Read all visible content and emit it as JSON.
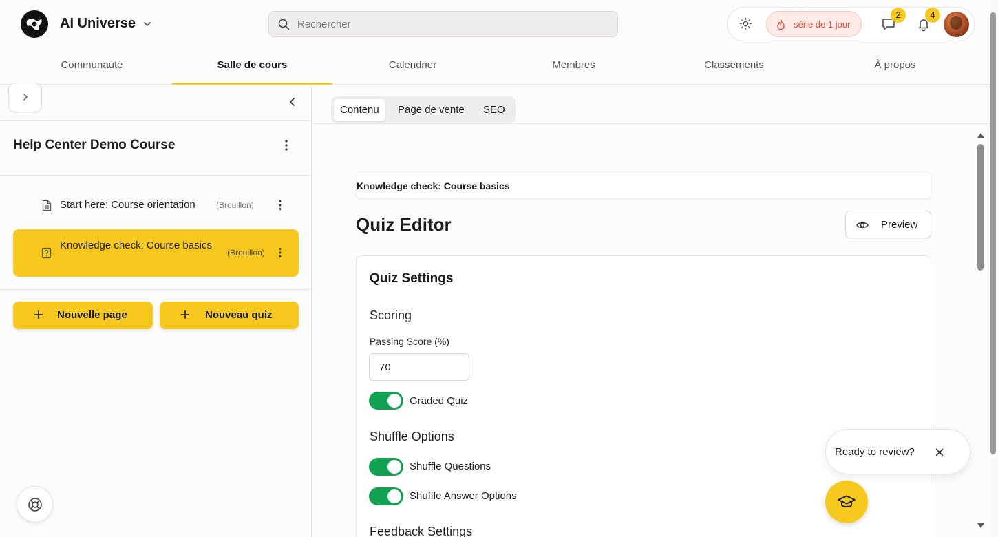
{
  "header": {
    "brand": "AI Universe",
    "search_placeholder": "Rechercher",
    "streak_label": "série de 1 jour",
    "messages_count": "2",
    "notifications_count": "4"
  },
  "nav": {
    "tabs": [
      {
        "label": "Communauté"
      },
      {
        "label": "Salle de cours"
      },
      {
        "label": "Calendrier"
      },
      {
        "label": "Membres"
      },
      {
        "label": "Classements"
      },
      {
        "label": "À propos"
      }
    ],
    "active": "Salle de cours"
  },
  "sidebar": {
    "course_title": "Help Center Demo Course",
    "lessons": [
      {
        "title": "Start here: Course orientation",
        "status": "(Brouillon)",
        "icon": "document-icon"
      },
      {
        "title": "Knowledge check: Course basics",
        "status": "(Brouillon)",
        "icon": "quiz-icon",
        "selected": true
      }
    ],
    "new_page_label": "Nouvelle page",
    "new_quiz_label": "Nouveau quiz"
  },
  "content": {
    "tabs": [
      {
        "label": "Contenu"
      },
      {
        "label": "Page de vente"
      },
      {
        "label": "SEO"
      }
    ],
    "active_tab": "Contenu",
    "item_title": "Knowledge check: Course basics",
    "editor_title": "Quiz Editor",
    "preview_label": "Preview",
    "settings": {
      "title": "Quiz Settings",
      "scoring_heading": "Scoring",
      "passing_score_label": "Passing Score (%)",
      "passing_score_value": "70",
      "graded_quiz_label": "Graded Quiz",
      "graded_quiz_on": true,
      "shuffle_heading": "Shuffle Options",
      "shuffle_questions_label": "Shuffle Questions",
      "shuffle_questions_on": true,
      "shuffle_answers_label": "Shuffle Answer Options",
      "shuffle_answers_on": true,
      "feedback_heading": "Feedback Settings"
    }
  },
  "floating": {
    "review_prompt": "Ready to review?"
  },
  "colors": {
    "accent": "#f7c91e",
    "toggle_on": "#12a150",
    "streak_text": "#de4d37",
    "streak_bg": "#fde9e5"
  }
}
